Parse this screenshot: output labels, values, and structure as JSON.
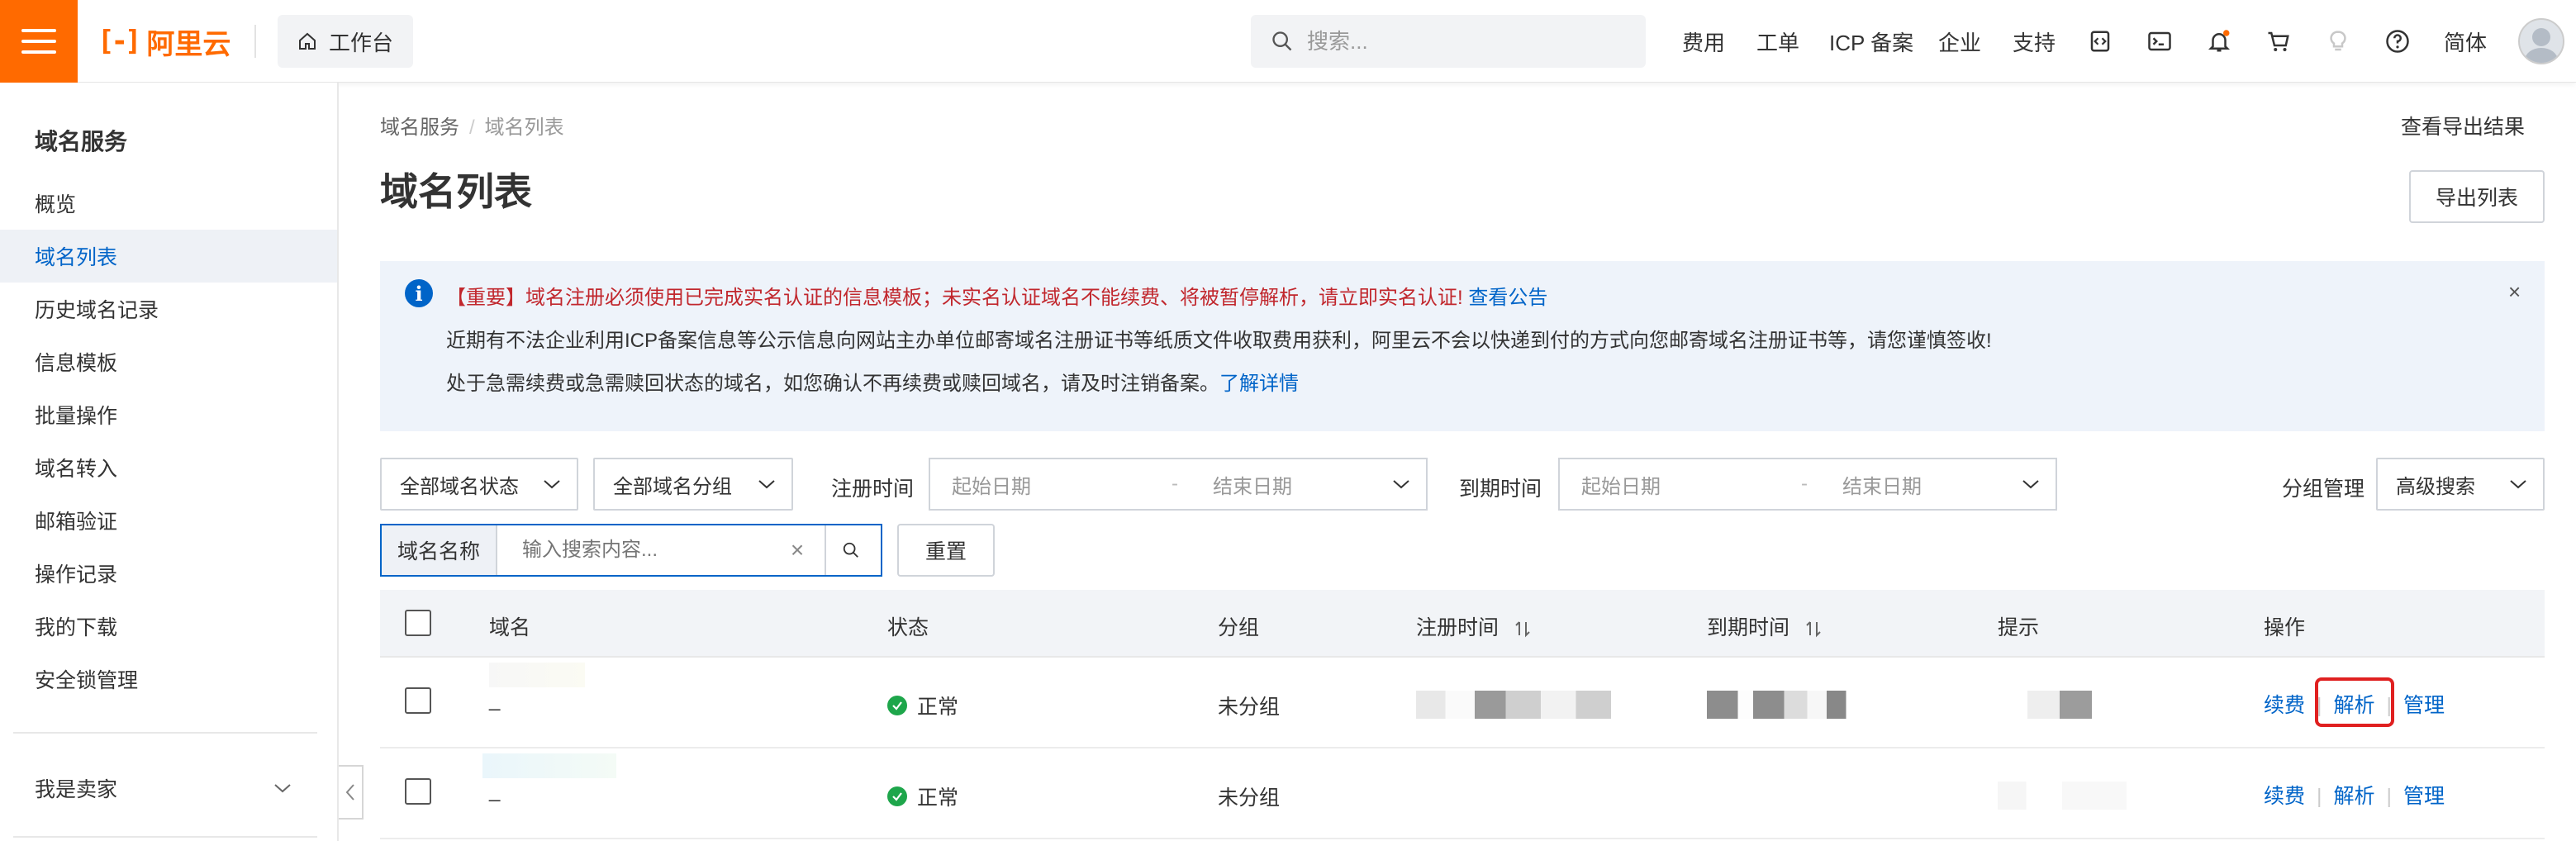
{
  "topbar": {
    "logo_text": "阿里云",
    "logo_mark": "[-]",
    "workbench_label": "工作台",
    "search_placeholder": "搜索...",
    "nav": [
      "费用",
      "工单",
      "ICP 备案",
      "企业",
      "支持"
    ],
    "lang": "简体",
    "icons": [
      "code-icon",
      "terminal-icon",
      "bell-icon",
      "cart-icon",
      "lightbulb-icon",
      "help-icon"
    ]
  },
  "sidebar": {
    "title": "域名服务",
    "items": [
      {
        "label": "概览"
      },
      {
        "label": "域名列表",
        "active": true
      },
      {
        "label": "历史域名记录"
      },
      {
        "label": "信息模板"
      },
      {
        "label": "批量操作"
      },
      {
        "label": "域名转入"
      },
      {
        "label": "邮箱验证"
      },
      {
        "label": "操作记录"
      },
      {
        "label": "我的下载"
      },
      {
        "label": "安全锁管理"
      }
    ],
    "seller_label": "我是卖家"
  },
  "main": {
    "breadcrumb": [
      "域名服务",
      "域名列表"
    ],
    "export_results_link": "查看导出结果",
    "title": "域名列表",
    "export_button": "导出列表",
    "notice": {
      "line1_red": "【重要】域名注册必须使用已完成实名认证的信息模板；未实名认证域名不能续费、将被暂停解析，请立即实名认证!",
      "line1_link": "查看公告",
      "line2": "近期有不法企业利用ICP备案信息等公示信息向网站主办单位邮寄域名注册证书等纸质文件收取费用获利，阿里云不会以快递到付的方式向您邮寄域名注册证书等，请您谨慎签收!",
      "line3": "处于急需续费或急需赎回状态的域名，如您确认不再续费或赎回域名，请及时注销备案。",
      "line3_link": "了解详情",
      "close": "×"
    },
    "filters": {
      "status_select": "全部域名状态",
      "group_select": "全部域名分组",
      "reg_time_label": "注册时间",
      "expire_time_label": "到期时间",
      "start_date_placeholder": "起始日期",
      "end_date_placeholder": "结束日期",
      "range_separator": "-",
      "group_manage": "分组管理",
      "advanced_search": "高级搜索",
      "search_field_label": "域名名称",
      "search_placeholder": "输入搜索内容...",
      "reset_button": "重置"
    },
    "table": {
      "headers": [
        "域名",
        "状态",
        "分组",
        "注册时间",
        "到期时间",
        "提示",
        "操作"
      ],
      "rows": [
        {
          "domain": "_",
          "status": "正常",
          "group": "未分组",
          "actions": [
            "续费",
            "解析",
            "管理"
          ]
        },
        {
          "domain": "_",
          "status": "正常",
          "group": "未分组",
          "actions": [
            "续费",
            "解析",
            "管理"
          ]
        }
      ]
    }
  },
  "colors": {
    "brand": "#ff6a00",
    "link": "#0064c8",
    "alert_red": "#c1272d",
    "ok_green": "#1ea64b",
    "highlight": "#e02020"
  }
}
